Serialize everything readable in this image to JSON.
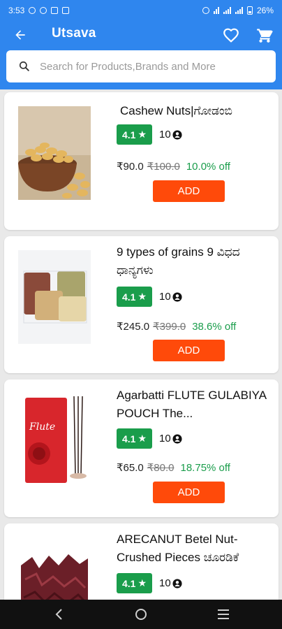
{
  "status_bar": {
    "time": "3:53",
    "battery": "26%"
  },
  "app_bar": {
    "title": "Utsava",
    "icons": [
      "back-arrow-icon",
      "heart-icon",
      "cart-icon"
    ]
  },
  "search": {
    "placeholder": "Search for Products,Brands and More",
    "value": ""
  },
  "colors": {
    "brand": "#2f86ee",
    "rating": "#1a9d4b",
    "add_button": "#ff4a0a",
    "discount": "#1a9d4b"
  },
  "products": [
    {
      "name": "Cashew Nuts|ಗೋಡಂಬಿ",
      "rating": "4.1",
      "reviews": "10",
      "price": "₹90.0",
      "mrp": "₹100.0",
      "discount": "10.0% off",
      "add_label": "ADD"
    },
    {
      "name": "9 types of grains 9 ವಿಧದ ಧಾನ್ಯಗಳು",
      "rating": "4.1",
      "reviews": "10",
      "price": "₹245.0",
      "mrp": "₹399.0",
      "discount": "38.6% off",
      "add_label": "ADD"
    },
    {
      "name": "Agarbatti FLUTE GULABIYA POUCH The...",
      "rating": "4.1",
      "reviews": "10",
      "price": "₹65.0",
      "mrp": "₹80.0",
      "discount": "18.75% off",
      "add_label": "ADD",
      "image_text": "Flute"
    },
    {
      "name": "ARECANUT Betel Nut- Crushed Pieces ಚೂರಡಿಕೆ",
      "rating": "4.1",
      "reviews": "10"
    }
  ]
}
